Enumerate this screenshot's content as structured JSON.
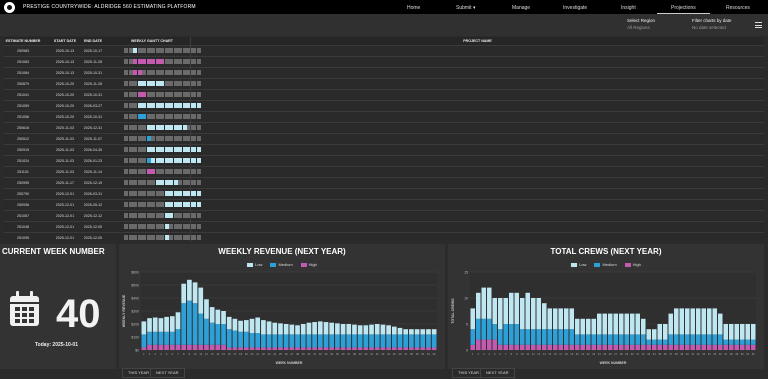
{
  "app": {
    "title": "PRESTIGE COUNTRYWIDE: ALDRIDGE 560 ESTIMATING PLATFORM"
  },
  "nav": {
    "items": [
      {
        "label": "Home",
        "active": false
      },
      {
        "label": "Submit",
        "active": false,
        "has_dropdown": true
      },
      {
        "label": "Manage",
        "active": false
      },
      {
        "label": "Investigate",
        "active": false
      },
      {
        "label": "Insight",
        "active": false
      },
      {
        "label": "Projections",
        "active": true
      },
      {
        "label": "Resources",
        "active": false
      }
    ]
  },
  "filters": {
    "region": {
      "label": "Select Region",
      "value": "All Regions"
    },
    "date": {
      "label": "Filter charts by date",
      "value": "No date selected"
    }
  },
  "table": {
    "headers": [
      "ESTIMATE NUMBER",
      "START DATE",
      "END DATE",
      "WEEKLY GANTT CHART",
      "PROJECT NAME"
    ],
    "weeks_shown": 17,
    "rows": [
      {
        "estimate": "250983",
        "start": "2025-10-13",
        "end": "2025-10-17",
        "bars": [
          [
            2,
            1,
            "low"
          ]
        ]
      },
      {
        "estimate": "251083",
        "start": "2025-10-13",
        "end": "2025-11-28",
        "bars": [
          [
            2,
            7,
            "high"
          ]
        ]
      },
      {
        "estimate": "251084",
        "start": "2025-10-13",
        "end": "2025-10-31",
        "bars": [
          [
            2,
            2,
            "high"
          ]
        ]
      },
      {
        "estimate": "250879",
        "start": "2025-10-20",
        "end": "2025-11-28",
        "bars": [
          [
            3,
            6,
            "low"
          ]
        ]
      },
      {
        "estimate": "251041",
        "start": "2025-10-20",
        "end": "2025-10-31",
        "bars": [
          [
            3,
            2,
            "high"
          ]
        ]
      },
      {
        "estimate": "251059",
        "start": "2025-10-20",
        "end": "2026-03-27",
        "bars": [
          [
            3,
            14,
            "low"
          ]
        ]
      },
      {
        "estimate": "251056",
        "start": "2025-10-20",
        "end": "2025-10-31",
        "bars": [
          [
            3,
            2,
            "medium"
          ]
        ]
      },
      {
        "estimate": "250616",
        "start": "2025-11-03",
        "end": "2025-12-31",
        "bars": [
          [
            5,
            9,
            "low"
          ]
        ]
      },
      {
        "estimate": "250512",
        "start": "2025-11-03",
        "end": "2025-11-07",
        "bars": [
          [
            5,
            1,
            "medium"
          ]
        ]
      },
      {
        "estimate": "250915",
        "start": "2025-11-03",
        "end": "2026-04-30",
        "bars": [
          [
            5,
            12,
            "low"
          ]
        ]
      },
      {
        "estimate": "251024",
        "start": "2025-11-03",
        "end": "2026-01-23",
        "bars": [
          [
            5,
            1,
            "medium"
          ],
          [
            6,
            11,
            "low"
          ]
        ]
      },
      {
        "estimate": "251101",
        "start": "2025-11-03",
        "end": "2025-11-14",
        "bars": [
          [
            5,
            2,
            "high"
          ]
        ]
      },
      {
        "estimate": "250995",
        "start": "2025-11-17",
        "end": "2025-12-19",
        "bars": [
          [
            7,
            5,
            "low"
          ]
        ]
      },
      {
        "estimate": "250790",
        "start": "2025-12-01",
        "end": "2026-03-31",
        "bars": [
          [
            9,
            8,
            "low"
          ]
        ]
      },
      {
        "estimate": "250936",
        "start": "2025-12-01",
        "end": "2026-05-12",
        "bars": [
          [
            9,
            8,
            "low"
          ]
        ]
      },
      {
        "estimate": "251057",
        "start": "2025-12-01",
        "end": "2025-12-12",
        "bars": [
          [
            9,
            2,
            "low"
          ]
        ]
      },
      {
        "estimate": "251048",
        "start": "2025-12-01",
        "end": "2025-12-05",
        "bars": [
          [
            9,
            1,
            "low"
          ]
        ]
      },
      {
        "estimate": "251095",
        "start": "2025-12-01",
        "end": "2025-12-05",
        "bars": [
          [
            9,
            1,
            "low"
          ]
        ]
      }
    ]
  },
  "current_week": {
    "title": "CURRENT WEEK NUMBER",
    "number": "40",
    "today": "Today: 2025-10-01"
  },
  "revenue_panel": {
    "title": "WEEKLY REVENUE (NEXT YEAR)",
    "buttons": [
      "THIS YEAR",
      "NEXT YEAR"
    ]
  },
  "crews_panel": {
    "title": "TOTAL CREWS (NEXT YEAR)",
    "buttons": [
      "THIS YEAR",
      "NEXT YEAR"
    ]
  },
  "colors": {
    "low": "#bfe7f2",
    "medium": "#2ea0d8",
    "high": "#c35ab0"
  },
  "chart_data": [
    {
      "type": "bar",
      "stacked": true,
      "title": "WEEKLY REVENUE (NEXT YEAR)",
      "xlabel": "WEEK NUMBER",
      "ylabel": "WEEKLY REVENUE",
      "ylim": [
        0,
        600
      ],
      "y_ticks": [
        "$0",
        "$100",
        "$200",
        "$300",
        "$400",
        "$500",
        "$600"
      ],
      "x": [
        1,
        2,
        3,
        4,
        5,
        6,
        7,
        8,
        9,
        10,
        11,
        12,
        13,
        14,
        15,
        16,
        17,
        18,
        19,
        20,
        21,
        22,
        23,
        24,
        25,
        26,
        27,
        28,
        29,
        30,
        31,
        32,
        33,
        34,
        35,
        36,
        37,
        38,
        39,
        40,
        41,
        42,
        43,
        44,
        45,
        46,
        47,
        48,
        49,
        50,
        51,
        52
      ],
      "series": [
        {
          "name": "Low",
          "color": "#bfe7f2",
          "values": [
            100,
            105,
            110,
            105,
            115,
            120,
            130,
            150,
            160,
            160,
            200,
            150,
            120,
            110,
            100,
            95,
            90,
            85,
            90,
            110,
            120,
            110,
            100,
            90,
            85,
            80,
            75,
            70,
            80,
            90,
            95,
            100,
            95,
            90,
            85,
            80,
            80,
            75,
            70,
            70,
            75,
            80,
            75,
            70,
            60,
            50,
            40,
            40,
            40,
            40,
            40,
            40
          ]
        },
        {
          "name": "Medium",
          "color": "#2ea0d8",
          "values": [
            100,
            100,
            100,
            100,
            100,
            100,
            120,
            320,
            340,
            320,
            240,
            200,
            170,
            160,
            160,
            140,
            130,
            120,
            120,
            110,
            110,
            100,
            100,
            100,
            100,
            100,
            100,
            100,
            100,
            100,
            100,
            100,
            100,
            100,
            100,
            100,
            100,
            100,
            100,
            100,
            100,
            100,
            100,
            100,
            100,
            100,
            100,
            100,
            100,
            100,
            100,
            100
          ]
        },
        {
          "name": "High",
          "color": "#c35ab0",
          "values": [
            20,
            40,
            40,
            40,
            40,
            40,
            40,
            40,
            40,
            40,
            40,
            40,
            40,
            40,
            40,
            20,
            20,
            20,
            20,
            20,
            20,
            20,
            20,
            20,
            20,
            20,
            20,
            20,
            20,
            20,
            20,
            20,
            20,
            20,
            20,
            20,
            20,
            20,
            20,
            20,
            20,
            20,
            20,
            20,
            20,
            20,
            20,
            20,
            20,
            20,
            20,
            20
          ]
        }
      ]
    },
    {
      "type": "bar",
      "stacked": true,
      "title": "TOTAL CREWS (NEXT YEAR)",
      "xlabel": "WEEK NUMBER",
      "ylabel": "TOTAL CREWS",
      "ylim": [
        0,
        15
      ],
      "y_ticks": [
        "0",
        "5",
        "10",
        "15"
      ],
      "x": [
        1,
        2,
        3,
        4,
        5,
        6,
        7,
        8,
        9,
        10,
        11,
        12,
        13,
        14,
        15,
        16,
        17,
        18,
        19,
        20,
        21,
        22,
        23,
        24,
        25,
        26,
        27,
        28,
        29,
        30,
        31,
        32,
        33,
        34,
        35,
        36,
        37,
        38,
        39,
        40,
        41,
        42,
        43,
        44,
        45,
        46,
        47,
        48,
        49,
        50,
        51,
        52
      ],
      "series": [
        {
          "name": "Low",
          "color": "#bfe7f2",
          "values": [
            4,
            5,
            6,
            6,
            5,
            6,
            5,
            6,
            6,
            6,
            7,
            6,
            6,
            5,
            4,
            4,
            4,
            4,
            4,
            3,
            3,
            3,
            3,
            4,
            4,
            4,
            4,
            4,
            4,
            4,
            4,
            3,
            2,
            2,
            3,
            3,
            4,
            5,
            5,
            5,
            5,
            5,
            5,
            5,
            5,
            4,
            3,
            3,
            3,
            3,
            3,
            3
          ]
        },
        {
          "name": "Medium",
          "color": "#2ea0d8",
          "values": [
            3,
            4,
            4,
            4,
            3,
            3,
            4,
            4,
            4,
            3,
            3,
            3,
            3,
            3,
            3,
            3,
            3,
            3,
            3,
            2,
            2,
            2,
            2,
            2,
            2,
            2,
            2,
            2,
            2,
            2,
            2,
            2,
            1,
            1,
            1,
            1,
            2,
            2,
            2,
            2,
            2,
            2,
            2,
            2,
            2,
            2,
            1,
            1,
            1,
            1,
            1,
            1
          ]
        },
        {
          "name": "High",
          "color": "#c35ab0",
          "values": [
            1,
            2,
            2,
            2,
            2,
            1,
            1,
            1,
            1,
            1,
            1,
            1,
            1,
            1,
            1,
            1,
            1,
            1,
            1,
            1,
            1,
            1,
            1,
            1,
            1,
            1,
            1,
            1,
            1,
            1,
            1,
            1,
            1,
            1,
            1,
            1,
            1,
            1,
            1,
            1,
            1,
            1,
            1,
            1,
            1,
            1,
            1,
            1,
            1,
            1,
            1,
            1
          ]
        }
      ]
    }
  ]
}
